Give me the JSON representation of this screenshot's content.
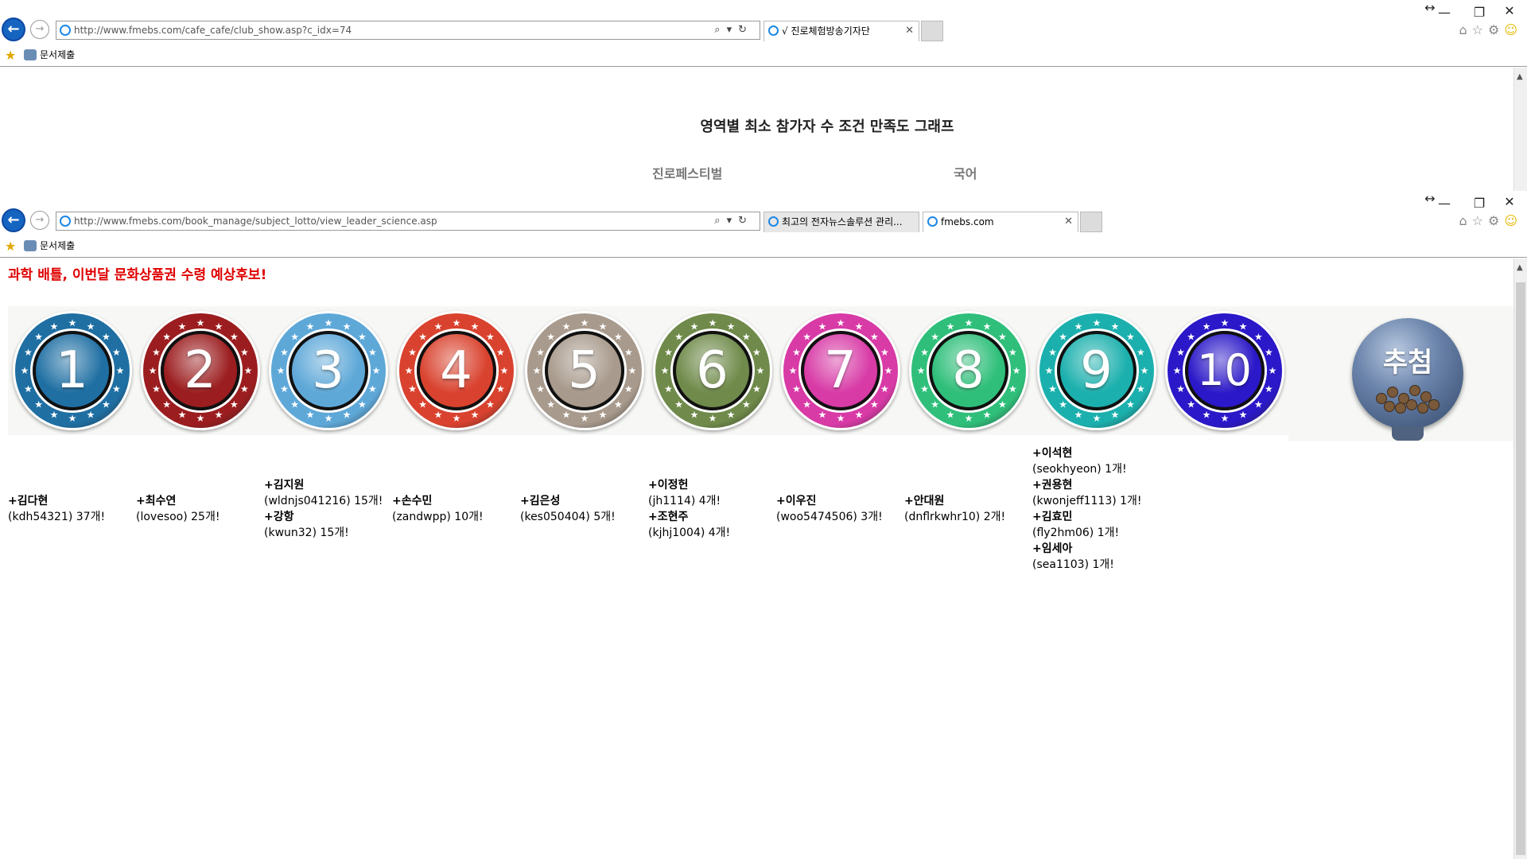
{
  "bg_window": {
    "url": "http://www.fmebs.com/cafe_cafe/club_show.asp?c_idx=74",
    "tabs": [
      {
        "label": "√ 진로체험방송기자단"
      }
    ],
    "favorites": [
      {
        "label": "문서제출"
      }
    ],
    "page": {
      "title": "영역별 최소 참가자 수 조건 만족도 그래프",
      "tab_labels": [
        "진로페스티벌",
        "국어"
      ]
    }
  },
  "main_window": {
    "url": "http://www.fmebs.com/book_manage/subject_lotto/view_leader_science.asp",
    "tabs": [
      {
        "label": "최고의 전자뉴스솔루션 관리..."
      },
      {
        "label": "fmebs.com"
      }
    ],
    "favorites": [
      {
        "label": "문서제출"
      }
    ],
    "page": {
      "headline": "과학 배틀, 이번달 문화상품권 수령 예상후보!",
      "balls": [
        {
          "number": "1",
          "color": "#1f6fa3"
        },
        {
          "number": "2",
          "color": "#9b1d1f"
        },
        {
          "number": "3",
          "color": "#5ea8d8"
        },
        {
          "number": "4",
          "color": "#d9422e"
        },
        {
          "number": "5",
          "color": "#a89a8c"
        },
        {
          "number": "6",
          "color": "#6f8a4a"
        },
        {
          "number": "7",
          "color": "#d83aa6"
        },
        {
          "number": "8",
          "color": "#2fbf7a"
        },
        {
          "number": "9",
          "color": "#1bb0ad"
        },
        {
          "number": "10",
          "color": "#2b18c8"
        }
      ],
      "draw_button": {
        "label": "추첨"
      },
      "winners": [
        [
          {
            "name": "+김다현",
            "detail": "(kdh54321) 37개!"
          }
        ],
        [
          {
            "name": "+최수연",
            "detail": "(lovesoo) 25개!"
          }
        ],
        [
          {
            "name": "+김지원",
            "detail": "(wldnjs041216) 15개!"
          },
          {
            "name": "+강항",
            "detail": "(kwun32) 15개!"
          }
        ],
        [
          {
            "name": "+손수민",
            "detail": "(zandwpp) 10개!"
          }
        ],
        [
          {
            "name": "+김은성",
            "detail": "(kes050404) 5개!"
          }
        ],
        [
          {
            "name": "+이정헌",
            "detail": "(jh1114) 4개!"
          },
          {
            "name": "+조현주",
            "detail": "(kjhj1004) 4개!"
          }
        ],
        [
          {
            "name": "+이우진",
            "detail": "(woo5474506) 3개!"
          }
        ],
        [
          {
            "name": "+안대원",
            "detail": "(dnflrkwhr10) 2개!"
          }
        ],
        [
          {
            "name": "+이석현",
            "detail": "(seokhyeon) 1개!"
          },
          {
            "name": "+권용현",
            "detail": "(kwonjeff1113) 1개!"
          },
          {
            "name": "+김효민",
            "detail": "(fly2hm06) 1개!"
          },
          {
            "name": "+임세아",
            "detail": "(sea1103) 1개!"
          }
        ],
        []
      ]
    }
  }
}
